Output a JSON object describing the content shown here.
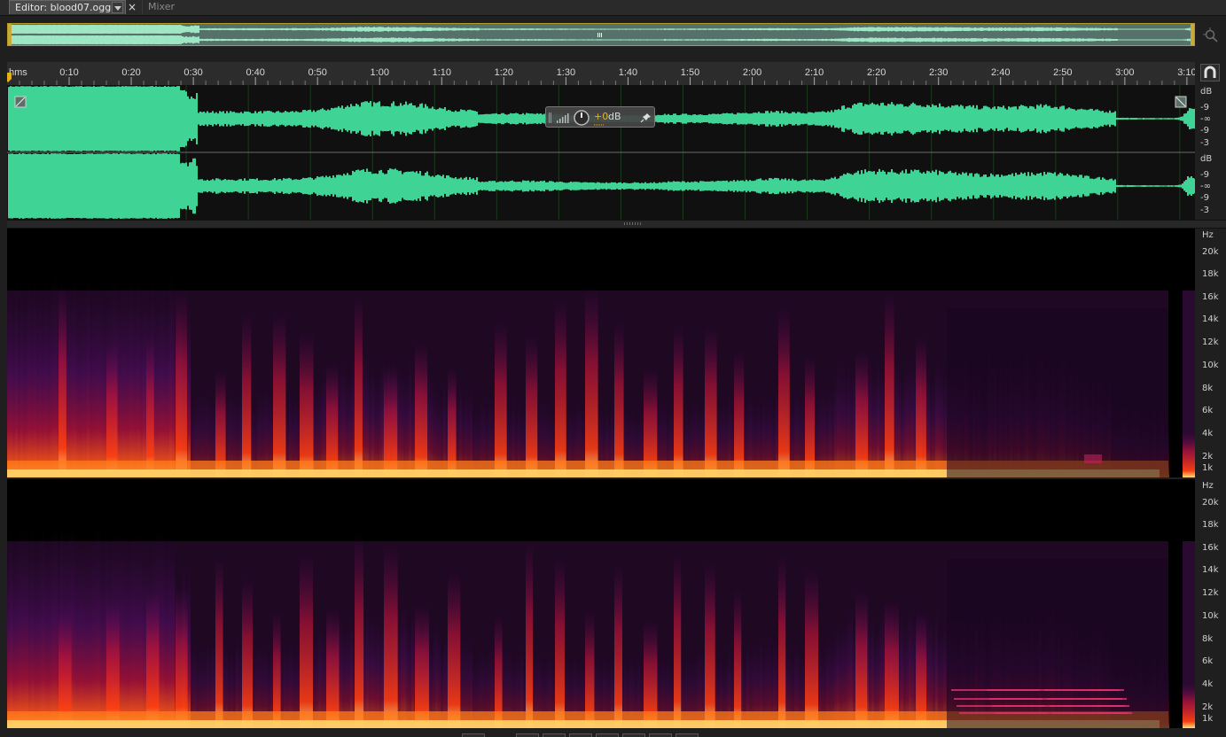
{
  "tabs": {
    "editor_label": "Editor: blood07.ogg",
    "close_label": "×",
    "mixer_label": "Mixer"
  },
  "ruler": {
    "unit": "hms",
    "ticks": [
      "0:10",
      "0:20",
      "0:30",
      "0:40",
      "0:50",
      "1:00",
      "1:10",
      "1:20",
      "1:30",
      "1:40",
      "1:50",
      "2:00",
      "2:10",
      "2:20",
      "2:30",
      "2:40",
      "2:50",
      "3:00",
      "3:10"
    ]
  },
  "waveform": {
    "db_labels": [
      "dB",
      "-9",
      "-∞",
      "-9",
      "-3"
    ],
    "channels": 2
  },
  "hud": {
    "value": "+0",
    "unit": "dB"
  },
  "spectral": {
    "hz_labels": [
      "Hz",
      "20k",
      "18k",
      "16k",
      "14k",
      "12k",
      "10k",
      "8k",
      "6k",
      "4k",
      "2k",
      "1k"
    ]
  },
  "colors": {
    "waveform": "#3fd495",
    "accent": "#e0b03a",
    "overview_border": "#b29b2a"
  },
  "icons": {
    "zoom": "zoom-icon",
    "snap": "magnet-icon",
    "playhead": "playhead-marker-icon"
  }
}
